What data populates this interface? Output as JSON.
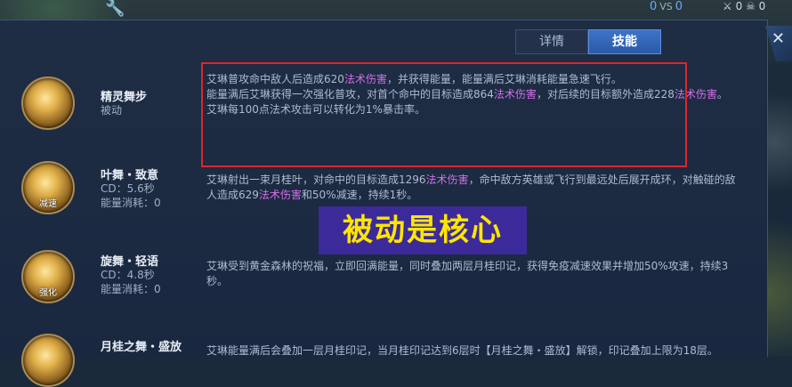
{
  "topbar": {
    "score_left": "0",
    "vs": "VS",
    "score_right": "0",
    "kd_left": "0",
    "kd_right": "0"
  },
  "tabs": [
    {
      "label": "详情",
      "active": false
    },
    {
      "label": "技能",
      "active": true
    }
  ],
  "skills": [
    {
      "name": "精灵舞步",
      "sub1": "被动",
      "desc_parts": [
        {
          "text": "艾琳普攻命中敌人后造成620",
          "magic": false
        },
        {
          "text": "法术伤害",
          "magic": true
        },
        {
          "text": "，并获得能量，能量满后艾琳消耗能量急速飞行。",
          "magic": false
        },
        {
          "text": "能量满后艾琳获得一次强化普攻，对首个命中的目标造成864",
          "magic": false
        },
        {
          "text": "法术伤害",
          "magic": true
        },
        {
          "text": "，对后续的目标额外造成228",
          "magic": false
        },
        {
          "text": "法术伤害",
          "magic": true
        },
        {
          "text": "。",
          "magic": false
        },
        {
          "text": "艾琳每100点法术攻击可以转化为1%暴击率。",
          "magic": false
        }
      ]
    },
    {
      "name": "叶舞・致意",
      "sub1": "CD：5.6秒",
      "sub2": "能量消耗：0",
      "icon_tag": "减速",
      "desc_parts": [
        {
          "text": "艾琳射出一束月桂叶，对命中的目标造成1296",
          "magic": false
        },
        {
          "text": "法术伤害",
          "magic": true
        },
        {
          "text": "，命中敌方英雄或飞行到最远处后展开成环，对触碰的敌人造成629",
          "magic": false
        },
        {
          "text": "法术伤害",
          "magic": true
        },
        {
          "text": "和50%减速，持续1秒。",
          "magic": false
        }
      ]
    },
    {
      "name": "旋舞・轻语",
      "sub1": "CD：4.8秒",
      "sub2": "能量消耗：0",
      "icon_tag": "强化",
      "desc": "艾琳受到黄金森林的祝福，立即回满能量，同时叠加两层月桂印记，获得免疫减速效果并增加50%攻速，持续3秒。"
    },
    {
      "name": "月桂之舞・盛放",
      "desc": "艾琳能量满后会叠加一层月桂印记，当月桂印记达到6层时【月桂之舞・盛放】解锁，印记叠加上限为18层。"
    }
  ],
  "caption": "被动是核心",
  "colors": {
    "magic": "#d16fe6",
    "highlight": "#e0242b",
    "caption_bg": "#3c2a9a",
    "caption_text": "#ffe600"
  }
}
